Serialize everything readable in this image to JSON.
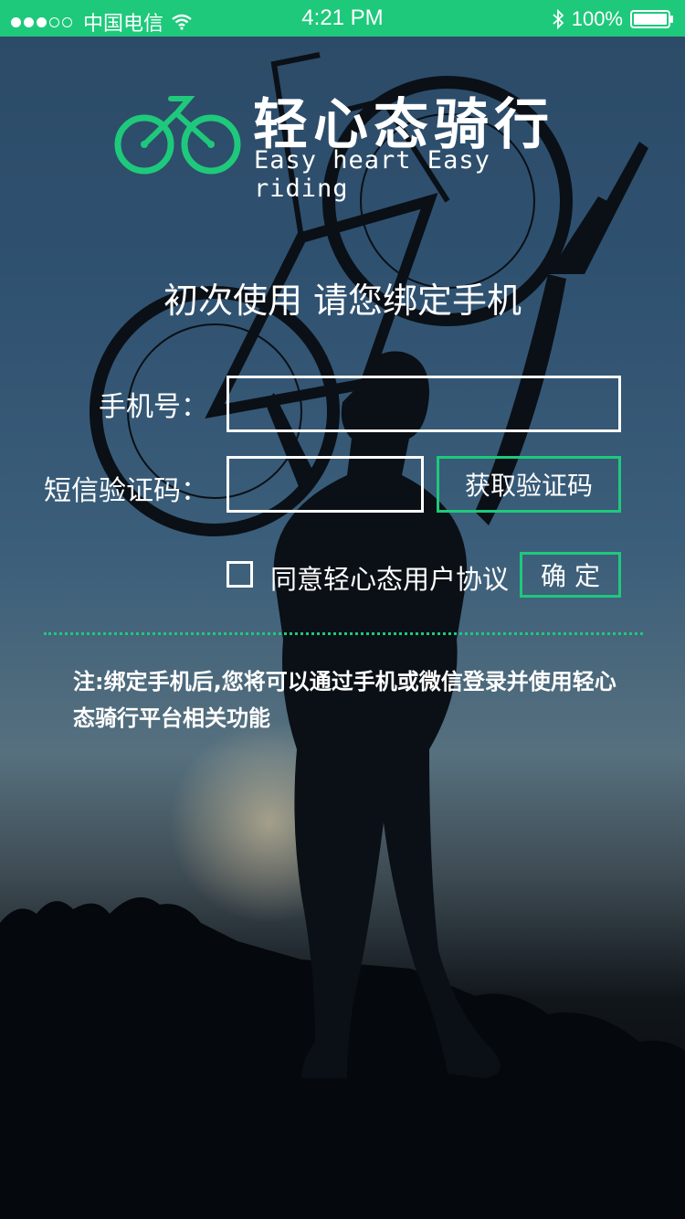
{
  "status_bar": {
    "carrier": "中国电信",
    "time": "4:21 PM",
    "battery": "100%",
    "signal_dots": [
      true,
      true,
      true,
      false,
      false
    ]
  },
  "brand": {
    "title": "轻心态骑行",
    "subtitle": "Easy heart Easy riding",
    "logo_icon": "bicycle-icon",
    "accent_color": "#1ec97b"
  },
  "headline": "初次使用 请您绑定手机",
  "form": {
    "phone_label": "手机号：",
    "phone_value": "",
    "code_label": "短信验证码：",
    "code_value": "",
    "get_code_button": "获取验证码",
    "agree_checked": false,
    "agree_label": "同意轻心态用户协议",
    "confirm_button": "确 定"
  },
  "note": "注:绑定手机后,您将可以通过手机或微信登录并使用轻心态骑行平台相关功能"
}
